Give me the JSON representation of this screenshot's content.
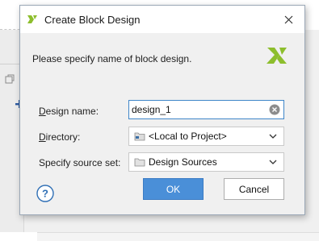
{
  "dialog": {
    "title": "Create Block Design",
    "instruction": "Please specify name of block design.",
    "fields": {
      "design_name": {
        "label_mnemonic": "D",
        "label_rest": "esign name:",
        "value": "design_1"
      },
      "directory": {
        "label_mnemonic": "D",
        "label_rest": "irectory:",
        "value": "<Local to Project>"
      },
      "source_set": {
        "label": "Specify source set:",
        "value": "Design Sources"
      }
    },
    "buttons": {
      "ok": "OK",
      "cancel": "Cancel"
    },
    "help_glyph": "?"
  },
  "colors": {
    "logo_green": "#8dbe2d",
    "primary_button": "#4a8fd8",
    "focus_border": "#3f86c9"
  },
  "icons": [
    "xilinx-logo-icon",
    "close-icon",
    "clear-icon",
    "folder-icon",
    "chevron-down-icon",
    "help-icon"
  ]
}
